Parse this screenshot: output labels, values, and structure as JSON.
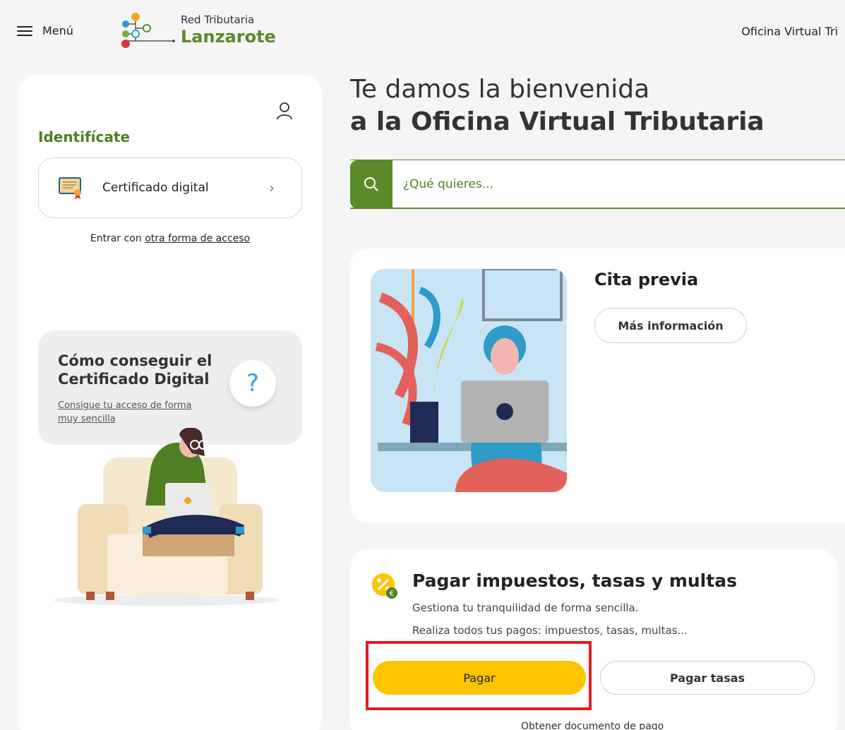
{
  "header": {
    "menu_label": "Menú",
    "logo_small": "Red Tributaria",
    "logo_big": "Lanzarote",
    "right_title": "Oficina Virtual Tri"
  },
  "login": {
    "title": "Identifícate",
    "cert_label": "Certificado digital",
    "alt_prefix": "Entrar con ",
    "alt_link": "otra forma de acceso"
  },
  "help": {
    "title": "Cómo conseguir el Certificado Digital",
    "link": "Consigue tu acceso de forma muy sencilla",
    "q_glyph": "?"
  },
  "welcome": {
    "line1": "Te damos la bienvenida",
    "line2": "a la Oficina Virtual Tributaria"
  },
  "search": {
    "placeholder": "¿Qué quieres..."
  },
  "cita": {
    "title": "Cita previa",
    "button": "Más información"
  },
  "pay": {
    "title": "Pagar impuestos, tasas y multas",
    "desc1": "Gestiona tu tranquilidad de forma sencilla.",
    "desc2": "Realiza todos tus pagos: impuestos, tasas, multas...",
    "pagar": "Pagar",
    "pagar_tasas": "Pagar tasas",
    "obtener": "Obtener documento de pago"
  },
  "colors": {
    "brand_green": "#5b8a2b",
    "accent_yellow": "#fcc500",
    "highlight_red": "#e21b23"
  }
}
